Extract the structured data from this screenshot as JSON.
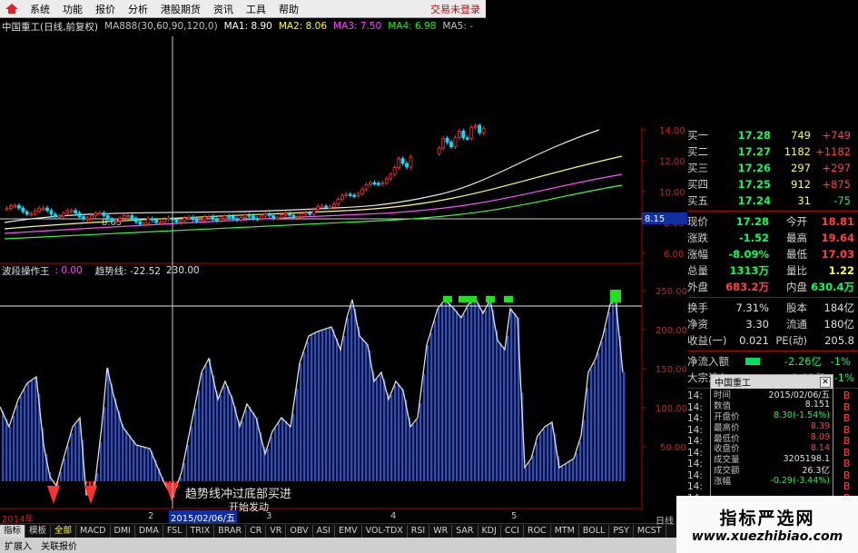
{
  "menu": {
    "items": [
      "系统",
      "功能",
      "报价",
      "分析",
      "港股期货",
      "资讯",
      "工具",
      "帮助"
    ],
    "login": "交易未登录"
  },
  "main_header": {
    "stock": "中国重工(日线,前复权)",
    "ma_formula": "MA888(30,60,90,120,0)",
    "ma1": "MA1: 8.90",
    "ma2": "MA2: 8.06",
    "ma3": "MA3: 7.50",
    "ma4": "MA4: 6.98",
    "ma5": "MA5: -",
    "colors": {
      "ma1": "#ffffff",
      "ma2": "#ffff00",
      "ma3": "#ff00ff",
      "ma4": "#00ff00",
      "ma5": "#c0c0c0"
    }
  },
  "price_axis": {
    "ticks": [
      "14.00",
      "12.00",
      "10.00",
      "8.00",
      "6.00"
    ],
    "current": "8.15",
    "low_label": "8.05"
  },
  "indicator_header": {
    "name": "波段操作王",
    "v1": ": 0.00",
    "label2": "趋势线: -22.52",
    "v3": "230.00"
  },
  "indicator_axis": {
    "ticks": [
      "250.00",
      "200.00",
      "150.00",
      "100.00",
      "50.00"
    ]
  },
  "indicator_annotations": {
    "line1": "趋势线冲过底部买进",
    "line2": "开始发动"
  },
  "bottom_dates": {
    "year": "2014年",
    "m2": "2",
    "date": "2015/02/06/五",
    "m3": "3",
    "m4": "4",
    "m5": "5"
  },
  "quote": {
    "asks": [
      {
        "label": "买一",
        "price": "17.28",
        "vol": "749",
        "chg": "+749"
      },
      {
        "label": "买二",
        "price": "17.27",
        "vol": "1182",
        "chg": "+1182"
      },
      {
        "label": "买三",
        "price": "17.26",
        "vol": "297",
        "chg": "+297"
      },
      {
        "label": "买四",
        "price": "17.25",
        "vol": "912",
        "chg": "+875"
      },
      {
        "label": "买五",
        "price": "17.24",
        "vol": "31",
        "chg": "-75"
      }
    ],
    "stats": [
      {
        "l1": "现价",
        "v1": "17.28",
        "l2": "今开",
        "v2": "18.81"
      },
      {
        "l1": "涨跌",
        "v1": "-1.52",
        "l2": "最高",
        "v2": "19.64"
      },
      {
        "l1": "涨幅",
        "v1": "-8.09%",
        "l2": "最低",
        "v2": "17.03"
      },
      {
        "l1": "总量",
        "v1": "1313万",
        "l2": "量比",
        "v2": "1.22"
      },
      {
        "l1": "外盘",
        "v1": "683.2万",
        "l2": "内盘",
        "v2": "630.4万"
      }
    ],
    "stats2": [
      {
        "l1": "换手",
        "v1": "7.31%",
        "l2": "股本",
        "v2": "184亿"
      },
      {
        "l1": "净资",
        "v1": "3.30",
        "l2": "流通",
        "v2": "180亿"
      },
      {
        "l1": "收益(一)",
        "v1": "0.021",
        "l2": "PE(动)",
        "v2": "205.8"
      }
    ],
    "flows": [
      {
        "label": "净流入额",
        "val": "-2.26亿",
        "pct": "-1%"
      },
      {
        "label": "大宗流入",
        "val": "-3.03亿",
        "pct": "-1%"
      }
    ],
    "ticks": [
      "14:",
      "14:",
      "14:",
      "14:",
      "14:",
      "14:",
      "14:",
      "14:",
      "14:",
      "14:",
      "14:",
      "14:"
    ],
    "tick_flags": [
      "B",
      "B",
      "B",
      "B",
      "B",
      "B",
      "B",
      "B",
      "B",
      "B",
      "B",
      "B"
    ]
  },
  "popup": {
    "title": "中国重工",
    "rows": [
      {
        "label": "时间",
        "value": "2015/02/06/五"
      },
      {
        "label": "数值",
        "value": "8.151"
      },
      {
        "label": "开盘价",
        "value": "8.30(-1.54%)"
      },
      {
        "label": "最高价",
        "value": "8.39"
      },
      {
        "label": "最低价",
        "value": "8.09"
      },
      {
        "label": "收盘价",
        "value": "8.14"
      },
      {
        "label": "成交量",
        "value": "3205198.1"
      },
      {
        "label": "成交额",
        "value": "26.3亿"
      },
      {
        "label": "涨幅",
        "value": "-0.29(-3.44%)"
      }
    ]
  },
  "tabs": [
    "指标",
    "模板",
    "全部",
    "MACD",
    "DMI",
    "DMA",
    "FSL",
    "TRIX",
    "BRAR",
    "CR",
    "VR",
    "OBV",
    "ASI",
    "EMV",
    "VOL-TDX",
    "RSI",
    "WR",
    "SAR",
    "KDJ",
    "CCI",
    "ROC",
    "MTM",
    "BOLL",
    "PSY",
    "MCST"
  ],
  "bottom": {
    "expand": "扩展入",
    "related": "关联报价",
    "daily": "日线"
  },
  "watermark": {
    "title": "指标严选网",
    "url": "www.xuezhibiao.com"
  },
  "colors": {
    "up": "#ff3030",
    "down": "#00ffff",
    "bar": "#3050b8",
    "axis": "#b00000"
  }
}
